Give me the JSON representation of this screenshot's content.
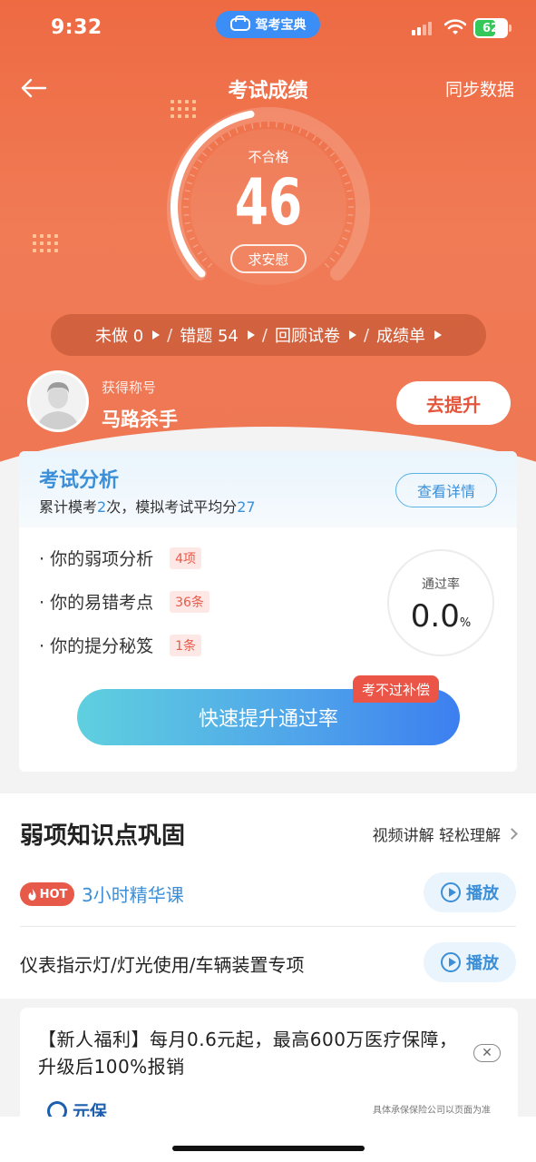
{
  "status_bar": {
    "time": "9:32",
    "app_name": "驾考宝典",
    "battery": "62"
  },
  "nav": {
    "title": "考试成绩",
    "sync_label": "同步数据"
  },
  "score": {
    "grade": "不合格",
    "value": "46",
    "comfort_label": "求安慰",
    "gauge_fraction": 0.46
  },
  "quick_links": [
    {
      "label": "未做 0"
    },
    {
      "label": "错题  54"
    },
    {
      "label": "回顾试卷"
    },
    {
      "label": "成绩单"
    }
  ],
  "user": {
    "title_label": "获得称号",
    "title_name": "马路杀手",
    "improve_label": "去提升"
  },
  "analysis": {
    "title": "考试分析",
    "summary_prefix": "累计模考",
    "exam_count": "2",
    "summary_mid": "次，模拟考试平均分",
    "avg_score": "27",
    "detail_label": "查看详情",
    "items": [
      {
        "label": "· 你的弱项分析",
        "badge": "4项"
      },
      {
        "label": "· 你的易错考点",
        "badge": "36条"
      },
      {
        "label": "· 你的提分秘笈",
        "badge": "1条"
      }
    ],
    "pass_rate_label": "通过率",
    "pass_rate_value": "0.0",
    "pass_rate_unit": "%",
    "boost_label": "快速提升通过率",
    "compensation_tag": "考不过补偿"
  },
  "weak_points": {
    "title": "弱项知识点巩固",
    "right_label": "视频讲解 轻松理解",
    "courses": [
      {
        "hot": "HOT",
        "name": "3小时精华课",
        "play_label": "播放"
      },
      {
        "name": "仪表指示灯/灯光使用/车辆装置专项",
        "play_label": "播放"
      }
    ]
  },
  "ad": {
    "text": "【新人福利】每月0.6元起，最高600万医疗保障，升级后100%报销",
    "close": "✕",
    "brand": "元保",
    "note": "具体承保保险公司以页面为准"
  },
  "colors": {
    "primary_orange": "#ee6a43",
    "accent_blue": "#3b8fd8",
    "hot_red": "#e75a4a"
  }
}
